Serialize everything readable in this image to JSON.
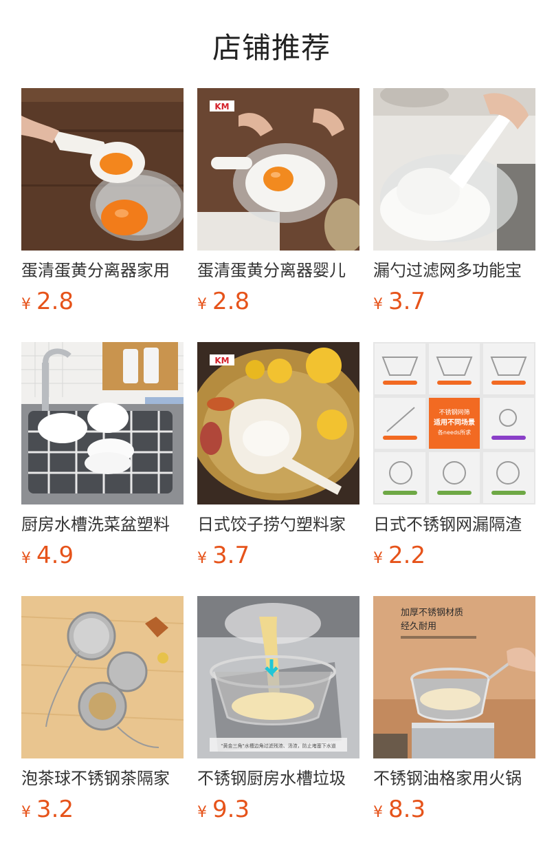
{
  "section_title": "店铺推荐",
  "colors": {
    "price": "#e6531a",
    "title": "#222222",
    "text": "#333333"
  },
  "products": [
    {
      "name": "蛋清蛋黄分离器家用",
      "currency": "¥",
      "price": "2.8",
      "image": "egg-separator-photo"
    },
    {
      "name": "蛋清蛋黄分离器婴儿",
      "currency": "¥",
      "price": "2.8",
      "image": "egg-separator-bowl-photo"
    },
    {
      "name": "漏勺过滤网多功能宝",
      "currency": "¥",
      "price": "3.7",
      "image": "flour-scoop-photo"
    },
    {
      "name": "厨房水槽洗菜盆塑料",
      "currency": "¥",
      "price": "4.9",
      "image": "sink-rack-photo"
    },
    {
      "name": "日式饺子捞勺塑料家",
      "currency": "¥",
      "price": "3.7",
      "image": "soup-ladle-photo"
    },
    {
      "name": "日式不锈钢网漏隔渣",
      "currency": "¥",
      "price": "2.2",
      "image": "strainer-grid-photo"
    },
    {
      "name": "泡茶球不锈钢茶隔家",
      "currency": "¥",
      "price": "3.2",
      "image": "tea-ball-photo"
    },
    {
      "name": "不锈钢厨房水槽垃圾",
      "currency": "¥",
      "price": "9.3",
      "image": "sink-basket-photo"
    },
    {
      "name": "不锈钢油格家用火锅",
      "currency": "¥",
      "price": "8.3",
      "image": "fry-basket-photo"
    }
  ],
  "image_text": {
    "brand_mark": "KM",
    "grid_center_line1": "不锈钢网筛",
    "grid_center_line2": "适用不同场景",
    "grid_center_line3": "各needs所求",
    "sink_caption": "\"黄金三角\"水槽边角过滤残渣、汤渣，防止堵塞下水道",
    "fry_line1": "加厚不锈钢材质",
    "fry_line2": "经久耐用"
  }
}
